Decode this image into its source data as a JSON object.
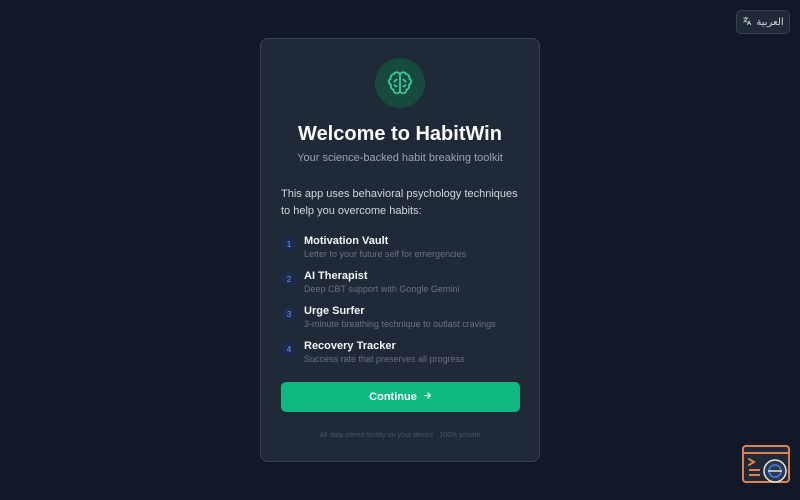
{
  "language_toggle": {
    "label": "العربية",
    "icon": "translate-icon"
  },
  "card": {
    "icon": "brain-icon",
    "title": "Welcome to HabitWin",
    "subtitle": "Your science-backed habit breaking toolkit",
    "intro": "This app uses behavioral psychology techniques to help you overcome habits:",
    "features": [
      {
        "num": "1",
        "title": "Motivation Vault",
        "desc": "Letter to your future self for emergencies"
      },
      {
        "num": "2",
        "title": "AI Therapist",
        "desc": "Deep CBT support with Google Gemini"
      },
      {
        "num": "3",
        "title": "Urge Surfer",
        "desc": "3-minute breathing technique to outlast cravings"
      },
      {
        "num": "4",
        "title": "Recovery Tracker",
        "desc": "Success rate that preserves all progress"
      }
    ],
    "continue_label": "Continue",
    "footer": "All data stored locally on your device · 100% private"
  },
  "colors": {
    "background": "#111827",
    "card": "#1f2937",
    "accent": "#10b981",
    "number_badge": "#60a5fa"
  }
}
